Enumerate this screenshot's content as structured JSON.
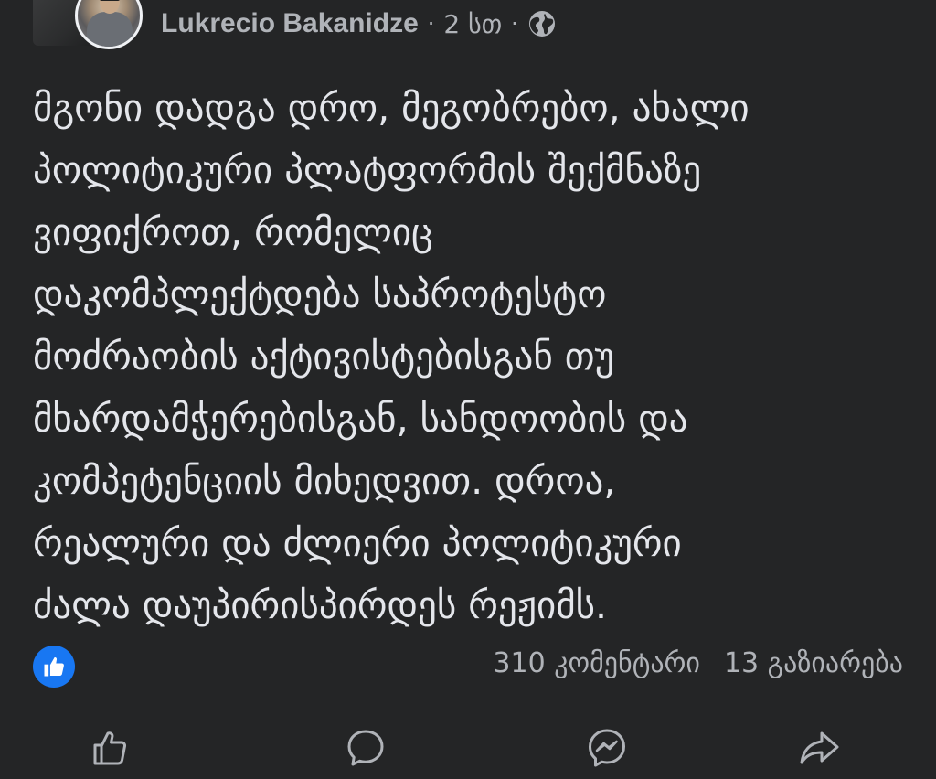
{
  "post": {
    "author": "Lukrecio Bakanidze",
    "separator": "·",
    "time": "2 სთ",
    "audience_icon": "globe-icon",
    "text_lines": [
      "მგონი დადგა დრო, მეგობრებო, ახალი",
      "პოლიტიკური პლატფორმის შექმნაზე",
      "ვიფიქროთ, რომელიც",
      "დაკომპლექტდება საპროტესტო",
      "მოძრაობის აქტივისტებისგან თუ",
      "მხარდამჭერებისგან, სანდოობის და",
      "კომპეტენციის მიხედვით. დროა,",
      "რეალური და ძლიერი პოლიტიკური",
      "ძალა დაუპირისპირდეს რეჟიმს."
    ]
  },
  "stats": {
    "reaction_icon": "like-reaction-icon",
    "comments": "310 კომენტარი",
    "shares": "13 გაზიარება"
  },
  "actions": {
    "icons": [
      "thumbs-up-icon",
      "comment-bubble-icon",
      "messenger-icon",
      "share-arrow-icon"
    ]
  },
  "colors": {
    "background": "#242526",
    "text": "#e4e6eb",
    "secondary_text": "#b0b3b8",
    "accent": "#1877f2"
  }
}
